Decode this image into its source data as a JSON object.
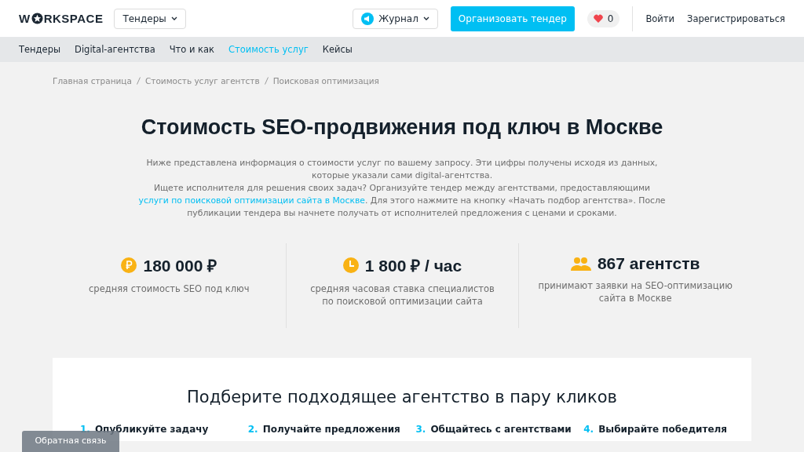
{
  "header": {
    "logo": {
      "before": "W",
      "after": "RKSPACE"
    },
    "tenders_dropdown": "Тендеры",
    "journal_dropdown": "Журнал",
    "cta": "Организовать тендер",
    "favorites": {
      "count": "0"
    },
    "login": "Войти",
    "register": "Зарегистрироваться"
  },
  "nav": [
    {
      "label": "Тендеры",
      "selected": false
    },
    {
      "label": "Digital-агентства",
      "selected": false
    },
    {
      "label": "Что и как",
      "selected": false
    },
    {
      "label": "Стоимость услуг",
      "selected": true
    },
    {
      "label": "Кейсы",
      "selected": false
    }
  ],
  "breadcrumbs": [
    "Главная страница",
    "Стоимость услуг агентств",
    "Поисковая оптимизация"
  ],
  "title": "Стоимость SEO-продвижения под ключ в Москве",
  "intro": "Ниже представлена информация о стоимости услуг по вашему запросу. Эти цифры получены исходя из данных, которые указали сами digital-агентства.",
  "intro2": {
    "before": "Ищете исполнителя для решения своих задач? Организуйте тендер между агентствами, предоставляющими",
    "link": "услуги по поисковой оптимизации сайта в Москве",
    "after": ". Для этого нажмите на кнопку «Начать подбор агентства». После публикации тендера вы начнете получать от исполнителей предложения с ценами и сроками."
  },
  "stats": [
    {
      "kind": "ruble",
      "value": "180 000 ₽",
      "caption": "средняя стоимость SEO под ключ"
    },
    {
      "kind": "clock",
      "value": "1 800 ₽ / час",
      "caption": "средняя часовая ставка специалистов по поисковой оптимизации сайта"
    },
    {
      "kind": "people",
      "value": "867 агентств",
      "caption": "принимают заявки на SEO-оптимизацию сайта в Москве"
    }
  ],
  "steps_card": {
    "title": "Подберите подходящее агентство в пару кликов",
    "steps": [
      {
        "number": "1.",
        "label": "Опубликуйте задачу"
      },
      {
        "number": "2.",
        "label": "Получайте предложения"
      },
      {
        "number": "3.",
        "label": "Общайтесь с агентствами"
      },
      {
        "number": "4.",
        "label": "Выбирайте победителя"
      }
    ]
  },
  "feedback_button": "Обратная связь"
}
